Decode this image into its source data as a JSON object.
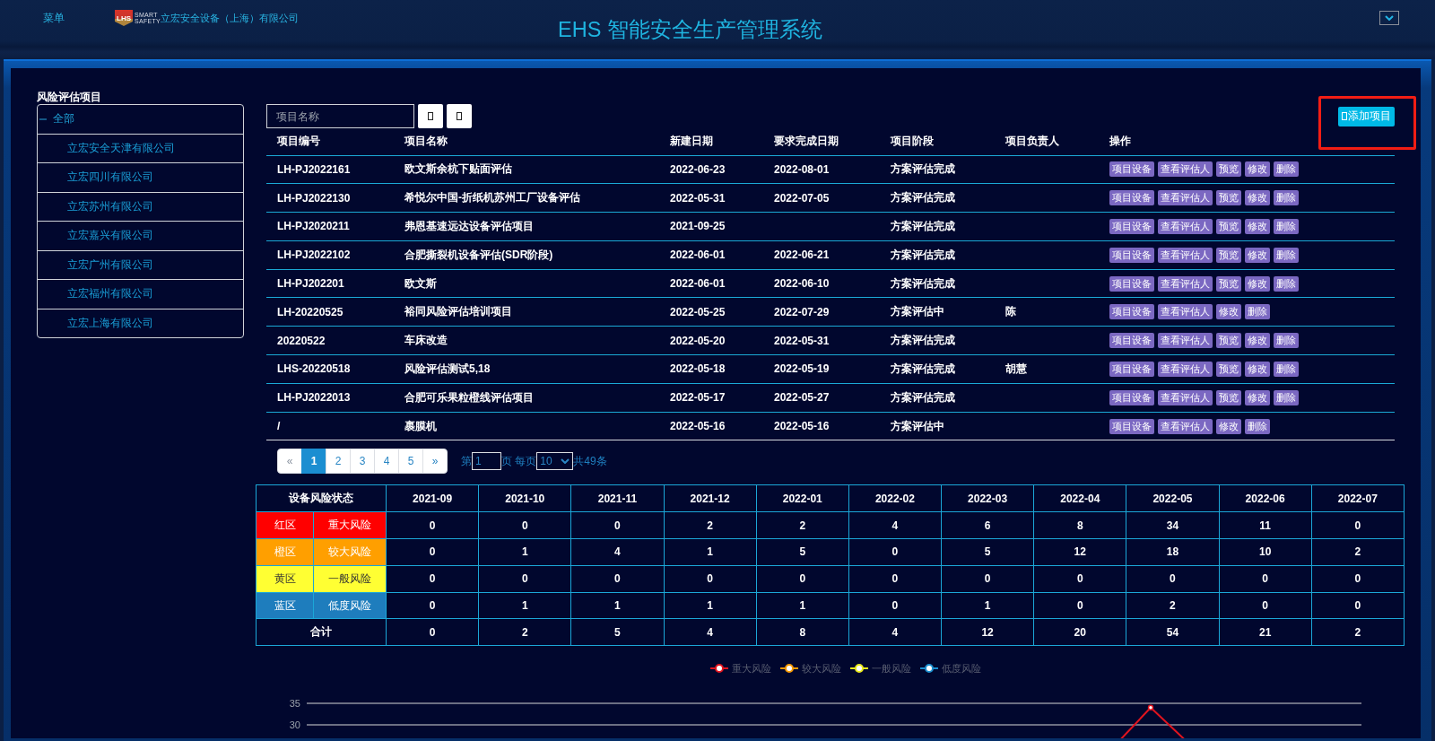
{
  "header": {
    "menu": "菜单",
    "logo": {
      "mark": "LHS",
      "tagline": "SMART SAFETY"
    },
    "company": "立宏安全设备（上海）有限公司",
    "title": "EHS 智能安全生产管理系统"
  },
  "sidebar": {
    "title": "风险评估项目",
    "tree": [
      {
        "label": "全部",
        "expanded": true,
        "children": [
          {
            "label": "立宏安全天津有限公司"
          },
          {
            "label": "立宏四川有限公司"
          },
          {
            "label": "立宏苏州有限公司"
          },
          {
            "label": "立宏嘉兴有限公司"
          },
          {
            "label": "立宏广州有限公司"
          },
          {
            "label": "立宏福州有限公司"
          },
          {
            "label": "立宏上海有限公司"
          }
        ]
      }
    ]
  },
  "toolbar": {
    "search": {
      "placeholder": "项目名称"
    },
    "add_button": {
      "label": "添加项目",
      "highlighted": true
    }
  },
  "projects": {
    "columns": [
      "项目编号",
      "项目名称",
      "新建日期",
      "要求完成日期",
      "项目阶段",
      "项目负责人",
      "操作"
    ],
    "rows": [
      {
        "code": "LH-PJ2022161",
        "name": "欧文斯余杭下贴面评估",
        "created": "2022-06-23",
        "due": "2022-08-01",
        "stage": "方案评估完成",
        "actions": [
          "项目设备",
          "查看评估人",
          "预览",
          "修改",
          "删除"
        ]
      },
      {
        "code": "LH-PJ2022130",
        "name": "希悦尔中国-折纸机苏州工厂设备评估",
        "created": "2022-05-31",
        "due": "2022-07-05",
        "stage": "方案评估完成",
        "actions": [
          "项目设备",
          "查看评估人",
          "预览",
          "修改",
          "删除"
        ]
      },
      {
        "code": "LH-PJ2020211",
        "name": "弗恩基速远达设备评估项目",
        "created": "2021-09-25",
        "stage": "方案评估完成",
        "actions": [
          "项目设备",
          "查看评估人",
          "预览",
          "修改",
          "删除"
        ]
      },
      {
        "code": "LH-PJ2022102",
        "name": "合肥撕裂机设备评估(SDR阶段)",
        "created": "2022-06-01",
        "due": "2022-06-21",
        "stage": "方案评估完成",
        "actions": [
          "项目设备",
          "查看评估人",
          "预览",
          "修改",
          "删除"
        ]
      },
      {
        "code": "LH-PJ202201",
        "name": "欧文斯",
        "created": "2022-06-01",
        "due": "2022-06-10",
        "stage": "方案评估完成",
        "actions": [
          "项目设备",
          "查看评估人",
          "预览",
          "修改",
          "删除"
        ]
      },
      {
        "code": "LH-20220525",
        "name": "裕同风险评估培训项目",
        "created": "2022-05-25",
        "due": "2022-07-29",
        "stage": "方案评估中",
        "owner": "陈",
        "actions": [
          "项目设备",
          "查看评估人",
          "修改",
          "删除"
        ]
      },
      {
        "code": "20220522",
        "name": "车床改造",
        "created": "2022-05-20",
        "due": "2022-05-31",
        "stage": "方案评估完成",
        "actions": [
          "项目设备",
          "查看评估人",
          "预览",
          "修改",
          "删除"
        ]
      },
      {
        "code": "LHS-20220518",
        "name": "风险评估测试5,18",
        "created": "2022-05-18",
        "due": "2022-05-19",
        "stage": "方案评估完成",
        "owner": "胡慧",
        "actions": [
          "项目设备",
          "查看评估人",
          "预览",
          "修改",
          "删除"
        ]
      },
      {
        "code": "LH-PJ2022013",
        "name": "合肥可乐果粒橙线评估项目",
        "created": "2022-05-17",
        "due": "2022-05-27",
        "stage": "方案评估完成",
        "actions": [
          "项目设备",
          "查看评估人",
          "预览",
          "修改",
          "删除"
        ]
      },
      {
        "code": "/",
        "name": "裹膜机",
        "created": "2022-05-16",
        "due": "2022-05-16",
        "stage": "方案评估中",
        "actions": [
          "项目设备",
          "查看评估人",
          "修改",
          "删除"
        ]
      }
    ]
  },
  "pagination": {
    "pages": [
      {
        "label": "«",
        "selected": false
      },
      {
        "label": "1",
        "selected": true
      },
      {
        "label": "2",
        "selected": false
      },
      {
        "label": "3",
        "selected": false
      },
      {
        "label": "4",
        "selected": false
      },
      {
        "label": "5",
        "selected": false
      },
      {
        "label": "»",
        "selected": false
      }
    ],
    "page_prefix": "第",
    "page_input": "1",
    "page_suffix": "页 每页",
    "page_size": "10",
    "total": "共49条"
  },
  "risk_summary": {
    "header": "设备风险状态",
    "months": [
      "2021-09",
      "2021-10",
      "2021-11",
      "2021-12",
      "2022-01",
      "2022-02",
      "2022-03",
      "2022-04",
      "2022-05",
      "2022-06",
      "2022-07"
    ],
    "rows": [
      {
        "zone": "红区",
        "level": "重大风险",
        "color": "#ff0000",
        "values": [
          "0",
          "0",
          "0",
          "2",
          "2",
          "4",
          "6",
          "8",
          "34",
          "11",
          "0"
        ]
      },
      {
        "zone": "橙区",
        "level": "较大风险",
        "color": "#ff9f00",
        "values": [
          "0",
          "1",
          "4",
          "1",
          "5",
          "0",
          "5",
          "12",
          "18",
          "10",
          "2"
        ]
      },
      {
        "zone": "黄区",
        "level": "一般风险",
        "color": "#ffff33",
        "values": [
          "0",
          "0",
          "0",
          "0",
          "0",
          "0",
          "0",
          "0",
          "0",
          "0",
          "0"
        ]
      },
      {
        "zone": "蓝区",
        "level": "低度风险",
        "color": "#1e7dbd",
        "values": [
          "0",
          "1",
          "1",
          "1",
          "1",
          "0",
          "1",
          "0",
          "2",
          "0",
          "0"
        ]
      }
    ],
    "total": {
      "label": "合计",
      "values": [
        "0",
        "2",
        "5",
        "4",
        "8",
        "4",
        "12",
        "20",
        "54",
        "21",
        "2"
      ]
    }
  },
  "risk_chart": {
    "legend": [
      {
        "name": "重大风险",
        "color": "#e0141e"
      },
      {
        "name": "较大风险",
        "color": "#f39800"
      },
      {
        "name": "一般风险",
        "color": "#e8e81a"
      },
      {
        "name": "低度风险",
        "color": "#1a8ccc"
      }
    ],
    "axis_labels": [
      "35",
      "30"
    ]
  }
}
